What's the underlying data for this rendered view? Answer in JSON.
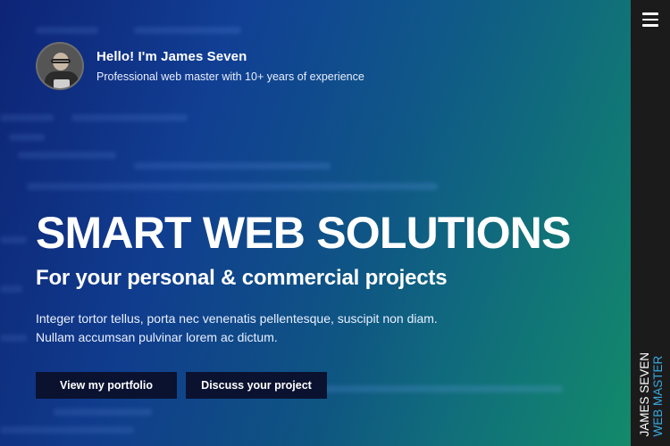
{
  "profile": {
    "greeting": "Hello! I'm James Seven",
    "tagline": "Professional web master with 10+ years of experience"
  },
  "hero": {
    "headline": "SMART WEB SOLUTIONS",
    "subheadline": "For your personal & commercial projects",
    "description_line1": "Integer tortor tellus, porta nec venenatis pellentesque, suscipit non diam.",
    "description_line2": "Nullam accumsan pulvinar lorem ac dictum."
  },
  "buttons": {
    "portfolio": "View my portfolio",
    "discuss": "Discuss your project"
  },
  "sidebar": {
    "menu_icon": "hamburger-menu-icon",
    "brand_name": "JAMES SEVEN",
    "brand_role": "WEB MASTER"
  },
  "colors": {
    "gradient_start": "#0f2a8a",
    "gradient_end": "#138a6a",
    "button_bg": "#0a1230",
    "sidebar_bg": "#1b1b1b",
    "accent": "#3aa9df"
  }
}
